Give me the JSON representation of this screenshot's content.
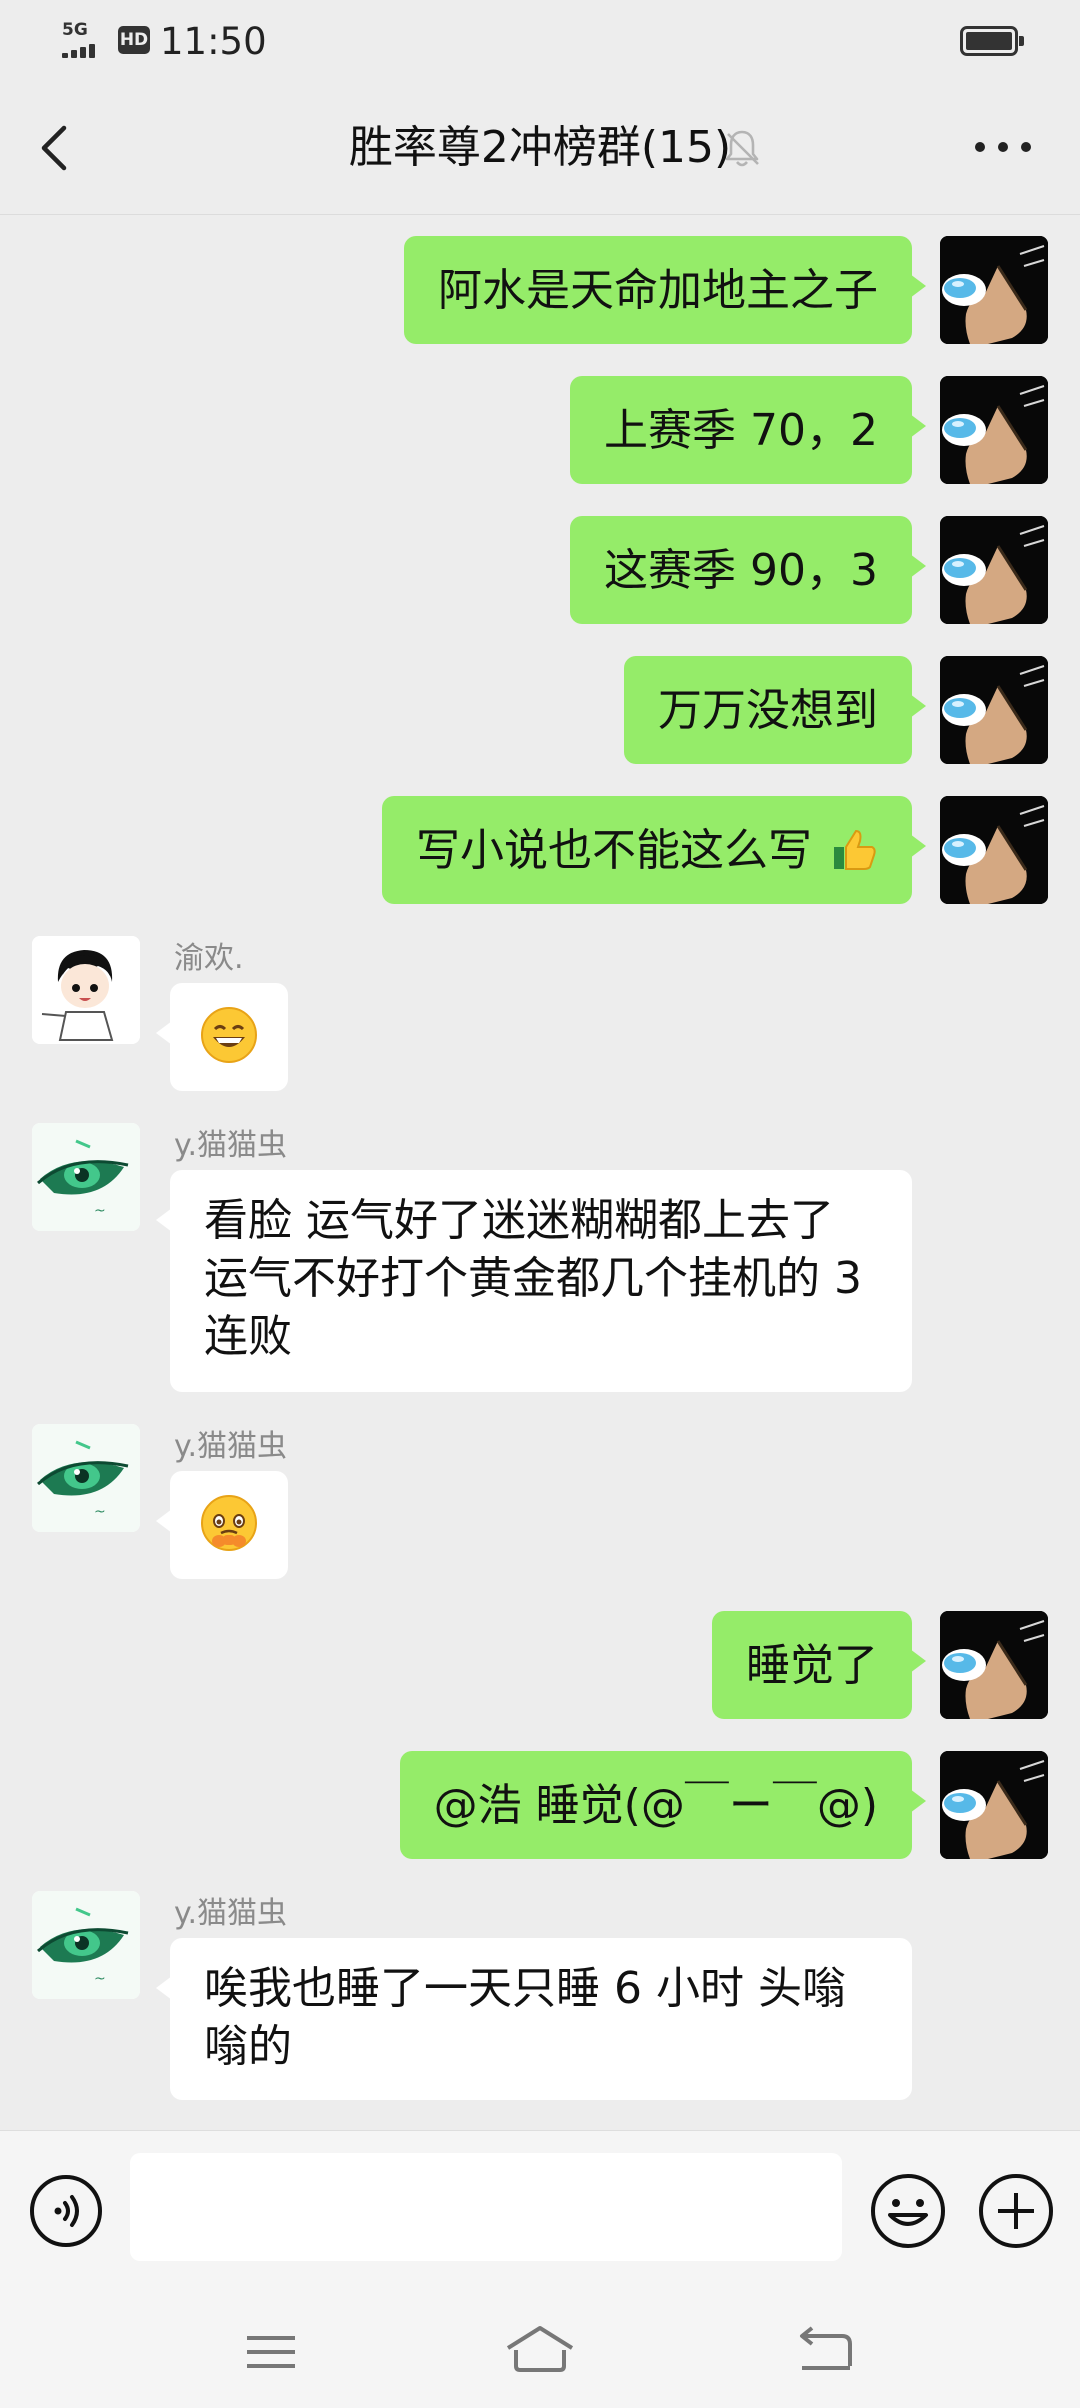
{
  "status_bar": {
    "network": "5G",
    "hd": "HD",
    "time": "11:50"
  },
  "header": {
    "title": "胜率尊2冲榜群(15)"
  },
  "messages": [
    {
      "from": "self",
      "text": "阿水是天命加地主之子"
    },
    {
      "from": "self",
      "text": "上赛季 70，2"
    },
    {
      "from": "self",
      "text": "这赛季 90，3"
    },
    {
      "from": "self",
      "text": "万万没想到"
    },
    {
      "from": "self",
      "text": "写小说也不能这么写",
      "emoji": "thumbs-up"
    },
    {
      "from": "other",
      "sender": "渝欢.",
      "emoji": "grinning-face"
    },
    {
      "from": "other",
      "sender": "y.猫猫虫",
      "lines": [
        "看脸 运气好了迷迷糊糊都上去了",
        "运气不好打个黄金都几个挂机的 3",
        "连败"
      ]
    },
    {
      "from": "other",
      "sender": "y.猫猫虫",
      "emoji": "face-holding-back-tears"
    },
    {
      "from": "self",
      "text": "睡觉了"
    },
    {
      "from": "self",
      "text": "@浩 睡觉(@￣ー￣@)"
    },
    {
      "from": "other",
      "sender": "y.猫猫虫",
      "lines": [
        "唉我也睡了一天只睡 6 小时  头嗡",
        "嗡的"
      ]
    }
  ],
  "input": {
    "value": "",
    "placeholder": ""
  },
  "colors": {
    "self_bubble": "#95ec69",
    "other_bubble": "#ffffff",
    "background": "#ededed"
  }
}
